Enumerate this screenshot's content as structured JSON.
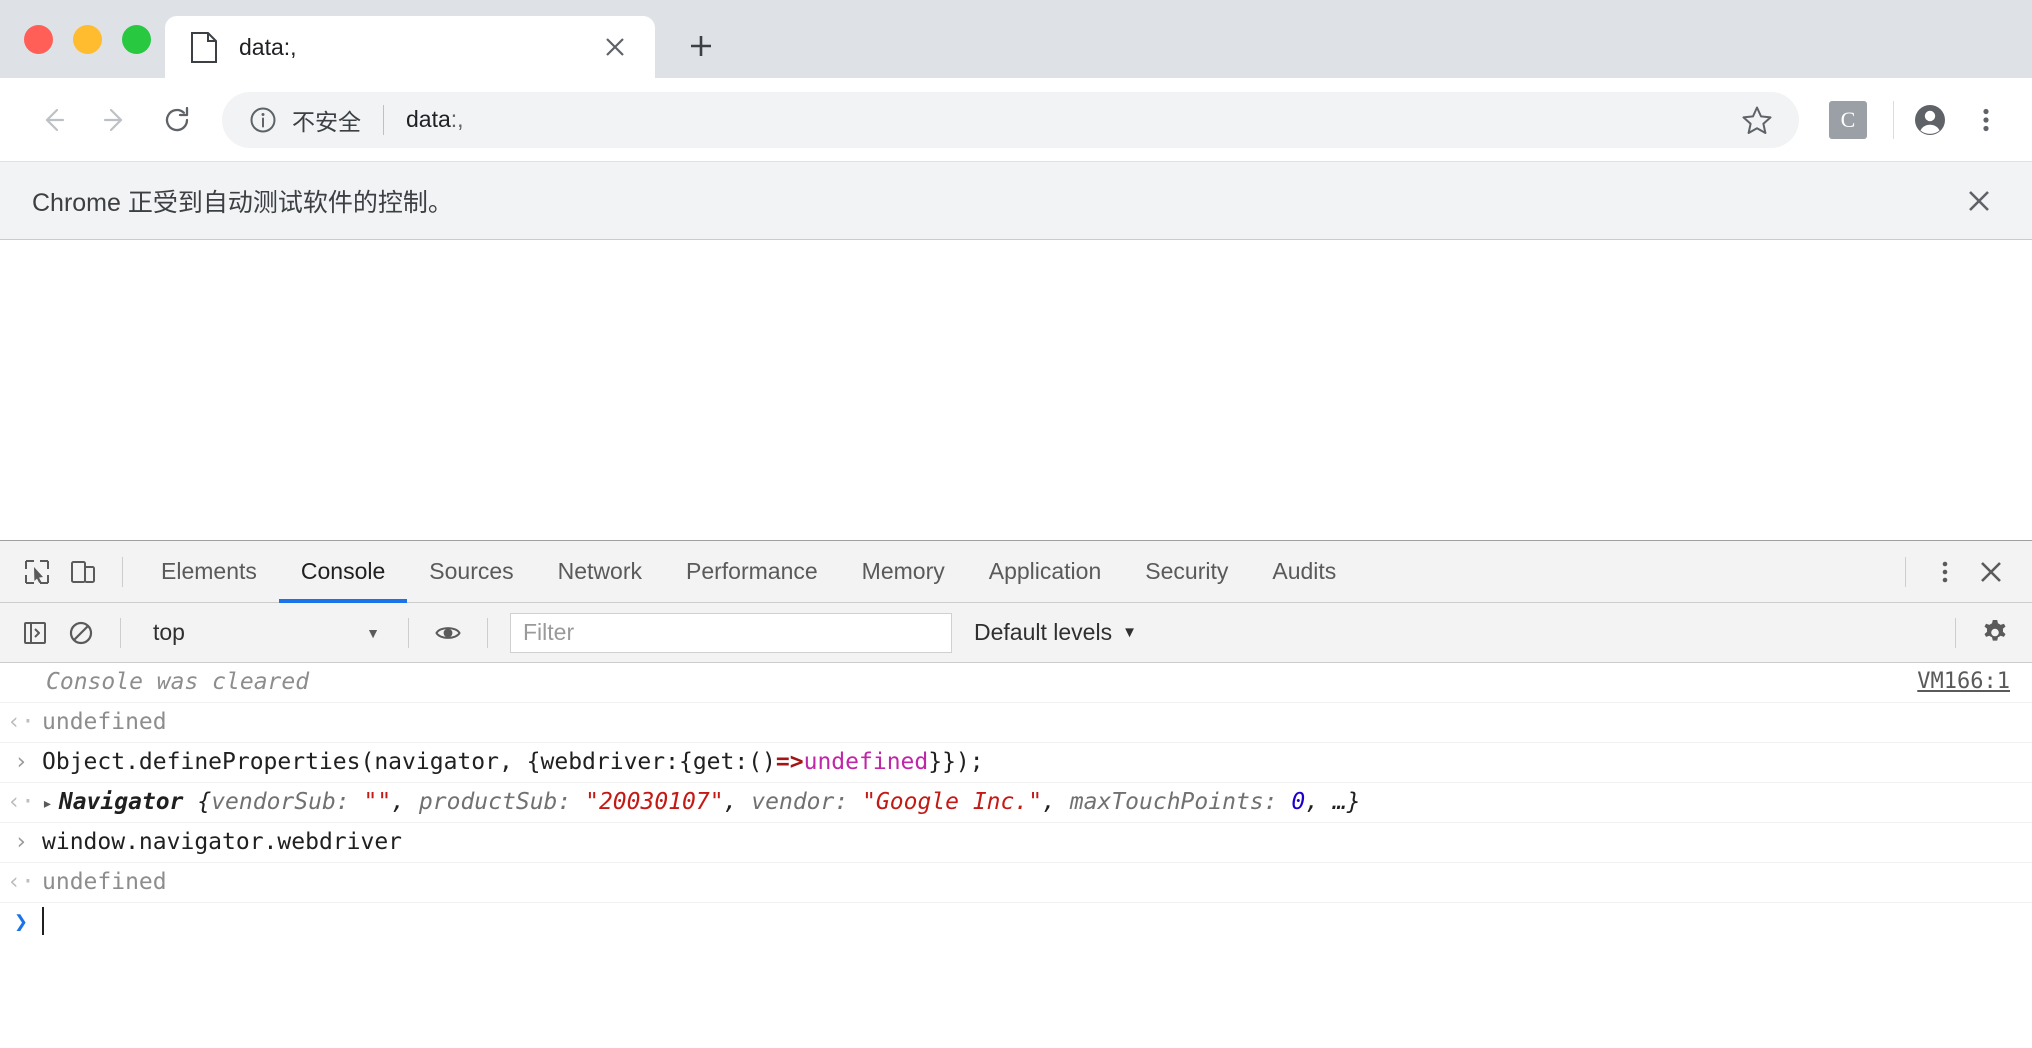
{
  "window": {
    "traffic_lights": [
      "close",
      "minimize",
      "maximize"
    ],
    "colors": {
      "close": "#ff5f57",
      "minimize": "#febc2e",
      "maximize": "#28c840",
      "accent": "#1a73e8"
    }
  },
  "tab": {
    "title": "data:,",
    "favicon": "page-icon",
    "close_label": "×",
    "newtab_label": "+"
  },
  "toolbar": {
    "back_label": "←",
    "forward_label": "→",
    "reload_label": "↻",
    "security_text": "不安全",
    "url_main": "data",
    "url_dim": ":,",
    "extension_label": "C",
    "star_label": "☆",
    "avatar_label": "profile",
    "menu_label": "⋮"
  },
  "infobar": {
    "message": "Chrome 正受到自动测试软件的控制。",
    "close_label": "✕"
  },
  "devtools": {
    "tabs": [
      {
        "label": "Elements",
        "active": false
      },
      {
        "label": "Console",
        "active": true
      },
      {
        "label": "Sources",
        "active": false
      },
      {
        "label": "Network",
        "active": false
      },
      {
        "label": "Performance",
        "active": false
      },
      {
        "label": "Memory",
        "active": false
      },
      {
        "label": "Application",
        "active": false
      },
      {
        "label": "Security",
        "active": false
      },
      {
        "label": "Audits",
        "active": false
      }
    ],
    "more_label": "⋮",
    "close_label": "✕",
    "filterbar": {
      "context": "top",
      "context_caret": "▼",
      "filter_placeholder": "Filter",
      "levels_label": "Default levels",
      "levels_caret": "▼"
    },
    "console": {
      "messages": [
        {
          "kind": "cleared",
          "gutter": "",
          "text": "Console was cleared",
          "source": "VM166:1"
        },
        {
          "kind": "result",
          "gutter": "‹·",
          "text": "undefined"
        },
        {
          "kind": "input",
          "gutter": "›",
          "parts": [
            {
              "t": "Object.defineProperties(navigator, {webdriver:{get:()",
              "c": "plain"
            },
            {
              "t": "=>",
              "c": "arrow"
            },
            {
              "t": "undefined",
              "c": "undef"
            },
            {
              "t": "}});",
              "c": "plain"
            }
          ]
        },
        {
          "kind": "object",
          "gutter": "‹·",
          "disclosure": "▸",
          "parts": [
            {
              "t": "Navigator ",
              "c": "name"
            },
            {
              "t": "{",
              "c": "punct"
            },
            {
              "t": "vendorSub: ",
              "c": "prop"
            },
            {
              "t": "\"\"",
              "c": "str"
            },
            {
              "t": ", ",
              "c": "punct"
            },
            {
              "t": "productSub: ",
              "c": "prop"
            },
            {
              "t": "\"20030107\"",
              "c": "str"
            },
            {
              "t": ", ",
              "c": "punct"
            },
            {
              "t": "vendor: ",
              "c": "prop"
            },
            {
              "t": "\"Google Inc.\"",
              "c": "str"
            },
            {
              "t": ", ",
              "c": "punct"
            },
            {
              "t": "maxTouchPoints: ",
              "c": "prop"
            },
            {
              "t": "0",
              "c": "num"
            },
            {
              "t": ", …}",
              "c": "punct"
            }
          ]
        },
        {
          "kind": "input",
          "gutter": "›",
          "parts": [
            {
              "t": "window.navigator.webdriver",
              "c": "plain"
            }
          ]
        },
        {
          "kind": "result",
          "gutter": "‹·",
          "text": "undefined"
        },
        {
          "kind": "prompt",
          "gutter": "❯",
          "text": ""
        }
      ]
    }
  }
}
